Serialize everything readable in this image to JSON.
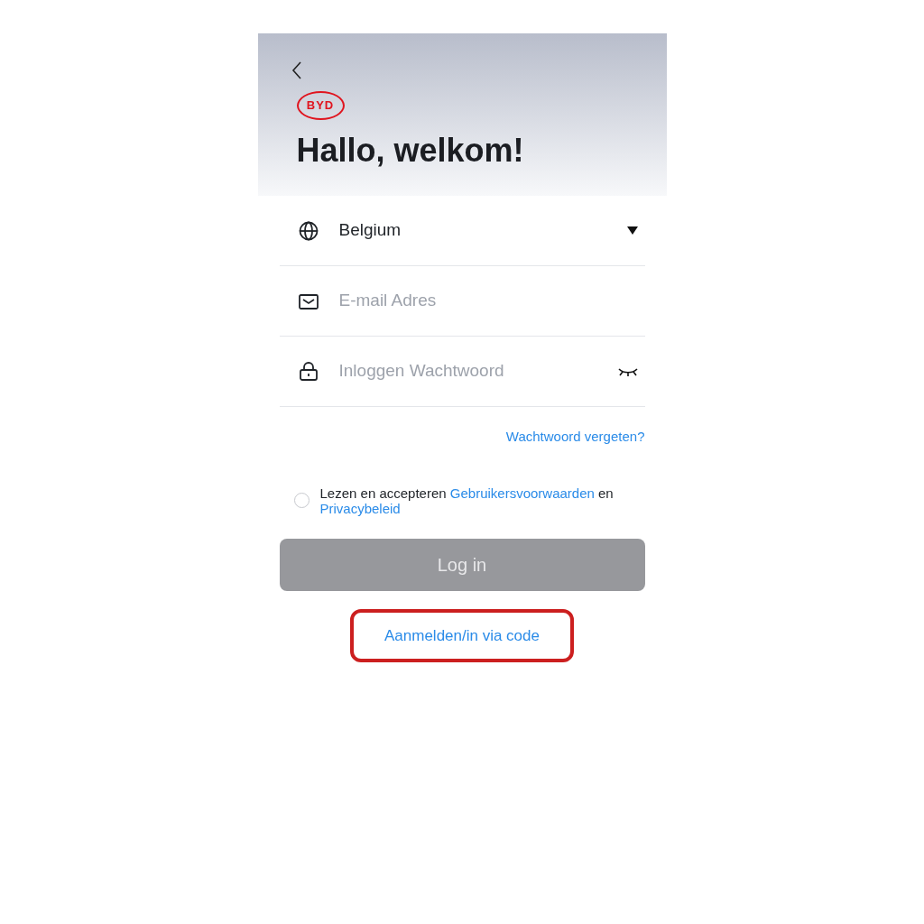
{
  "header": {
    "logo": "BYD",
    "title": "Hallo, welkom!"
  },
  "fields": [
    {
      "kind": "select",
      "value": "Belgium"
    },
    {
      "kind": "email",
      "placeholder": "E-mail Adres"
    },
    {
      "kind": "password",
      "placeholder": "Inloggen Wachtwoord"
    }
  ],
  "forgot_link": "Wachtwoord vergeten?",
  "consent": {
    "checked": false,
    "parts": [
      {
        "kind": "text",
        "text": "Lezen en accepteren "
      },
      {
        "kind": "link",
        "text": "Gebruikersvoorwaarden"
      },
      {
        "kind": "text",
        "text": " en "
      },
      {
        "kind": "link",
        "text": "Privacybeleid"
      }
    ]
  },
  "login_button": {
    "label": "Log in",
    "disabled": true
  },
  "code_link": {
    "label": "Aanmelden/in via code",
    "highlighted": true
  }
}
